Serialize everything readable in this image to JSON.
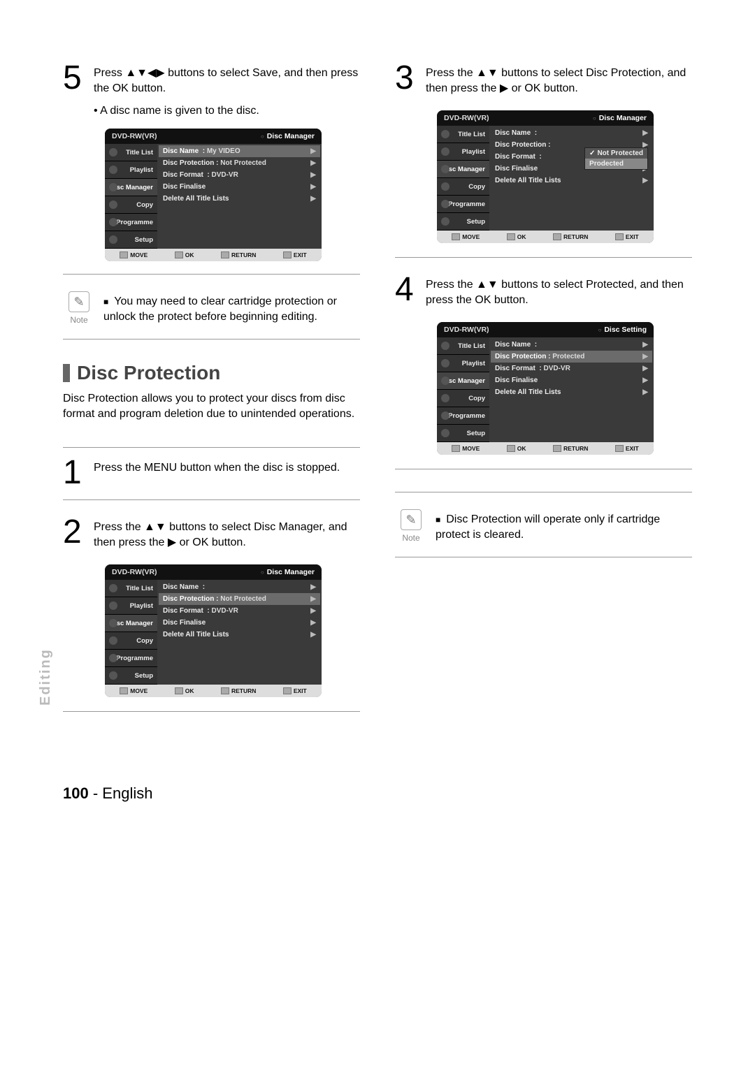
{
  "side_label": "Editing",
  "footer": {
    "page": "100",
    "lang": "English"
  },
  "left": {
    "step5": {
      "num": "5",
      "text": "Press ▲▼◀▶ buttons to select Save, and then press the OK button.",
      "sub": "• A disc name is given to the disc."
    },
    "note1": {
      "icon": "✎",
      "label": "Note",
      "text": "You may need to clear cartridge protection or unlock the protect before beginning editing."
    },
    "section": {
      "title": "Disc Protection",
      "body": "Disc Protection allows you to protect your discs from disc format and program deletion due to unintended operations."
    },
    "step1": {
      "num": "1",
      "text": "Press the MENU button when the disc is stopped."
    },
    "step2": {
      "num": "2",
      "text": "Press the ▲▼ buttons to select Disc Manager, and then press the ▶ or OK  button."
    }
  },
  "right": {
    "step3": {
      "num": "3",
      "text": "Press the ▲▼ buttons to select Disc Protection, and then press the ▶ or OK  button."
    },
    "step4": {
      "num": "4",
      "text": "Press the ▲▼ buttons to select Protected, and then press the OK button."
    },
    "note2": {
      "icon": "✎",
      "label": "Note",
      "text": "Disc Protection will operate only if cartridge protect is cleared."
    }
  },
  "osd": {
    "top_left": "DVD-RW(VR)",
    "top_right_manager": "Disc Manager",
    "top_right_setting": "Disc Setting",
    "side": [
      "Title List",
      "Playlist",
      "Disc Manager",
      "Copy",
      "Programme",
      "Setup"
    ],
    "foot": {
      "move": "MOVE",
      "ok": "OK",
      "return": "RETURN",
      "exit": "EXIT"
    },
    "rows_a": {
      "name_lbl": "Disc Name",
      "name_val": "My VIDEO",
      "prot_lbl": "Disc Protection",
      "prot_val": "Not Protected",
      "fmt_lbl": "Disc Format",
      "fmt_val": "DVD-VR",
      "fin": "Disc Finalise",
      "del": "Delete All Title Lists"
    },
    "rows_b": {
      "name_lbl": "Disc Name",
      "name_val": "",
      "prot_lbl": "Disc Protection",
      "prot_val": "Not Protected",
      "fmt_lbl": "Disc Format",
      "fmt_val": "DVD-VR",
      "fin": "Disc Finalise",
      "del": "Delete All Title Lists"
    },
    "rows_c": {
      "name_lbl": "Disc Name",
      "name_val": "",
      "prot_lbl": "Disc Protection",
      "prot_val": "",
      "fmt_lbl": "Disc Format",
      "fmt_val": "",
      "fin": "Disc Finalise",
      "del": "Delete All Title Lists",
      "popup": [
        "Not Protected",
        "Prodected"
      ]
    },
    "rows_d": {
      "name_lbl": "Disc Name",
      "name_val": "",
      "prot_lbl": "Disc Protection",
      "prot_val": "Protected",
      "fmt_lbl": "Disc Format",
      "fmt_val": "DVD-VR",
      "fin": "Disc Finalise",
      "del": "Delete All Title Lists"
    }
  }
}
